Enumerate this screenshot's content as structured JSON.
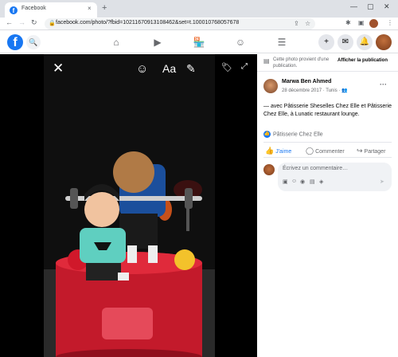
{
  "browser": {
    "tab_title": "Facebook",
    "tab_favicon": "f",
    "tab_close": "×",
    "new_tab": "+",
    "window_controls": [
      "—",
      "▢",
      "✕"
    ],
    "url": "facebook.com/photo/?fbid=10211670913108462&set=t.100010768057678"
  },
  "facebook": {
    "logo": "f"
  },
  "viewer": {
    "close": "✕",
    "tools": [
      "sticker-icon",
      "text-icon",
      "doodle-icon",
      "tag-icon",
      "expand-icon"
    ],
    "text_tool_label": "Aa"
  },
  "panel": {
    "notice_text": "Cette photo provient d'une publication.",
    "notice_button": "Afficher la publication",
    "author_name": "Marwa Ben Ahmed",
    "date": "28 décembre 2017 · Tunis · ",
    "caption": "— avec Pâtisserie Sheselles Chez Elle et Pâtisserie Chez Elle, à Lunatic restaurant lounge.",
    "reaction_name": "Pâtisserie Chez Elle",
    "actions": {
      "like": "J'aime",
      "comment": "Commenter",
      "share": "Partager"
    },
    "comment_placeholder": "Écrivez un commentaire…"
  },
  "colors": {
    "brand": "#1877f2",
    "photo_bg": "#000000"
  }
}
